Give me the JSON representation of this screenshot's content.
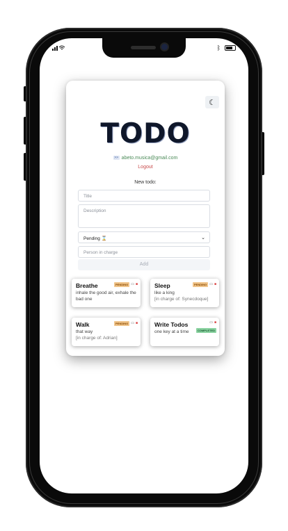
{
  "status": {
    "signal": "...",
    "bluetooth": "ᛒ"
  },
  "app": {
    "title": "TODO",
    "email": "abeto.musica@gmail.com",
    "logout": "Logout",
    "new_todo_label": "New todo:",
    "theme_icon": "moon-icon",
    "form": {
      "title_placeholder": "Title",
      "description_placeholder": "Description",
      "status_value": "Pending ⌛",
      "person_placeholder": "Person in charge",
      "add_label": "Add"
    },
    "todos": [
      {
        "name": "Breathe",
        "description": "inhale the good air, exhale the bad one",
        "charge": "",
        "status": "PENDING"
      },
      {
        "name": "Sleep",
        "description": "like a king",
        "charge": "[in charge of: Synecdoque]",
        "status": "PENDING"
      },
      {
        "name": "Walk",
        "description": "that way",
        "charge": "[in charge of: Adrian]",
        "status": "PENDING"
      },
      {
        "name": "Write Todos",
        "description": "one key at a time",
        "charge": "",
        "status": "COMPLETED"
      }
    ]
  },
  "colors": {
    "pending": "#f0c48a",
    "completed": "#8bd3a1",
    "logout": "#c84b4b",
    "email": "#4a8a57"
  }
}
